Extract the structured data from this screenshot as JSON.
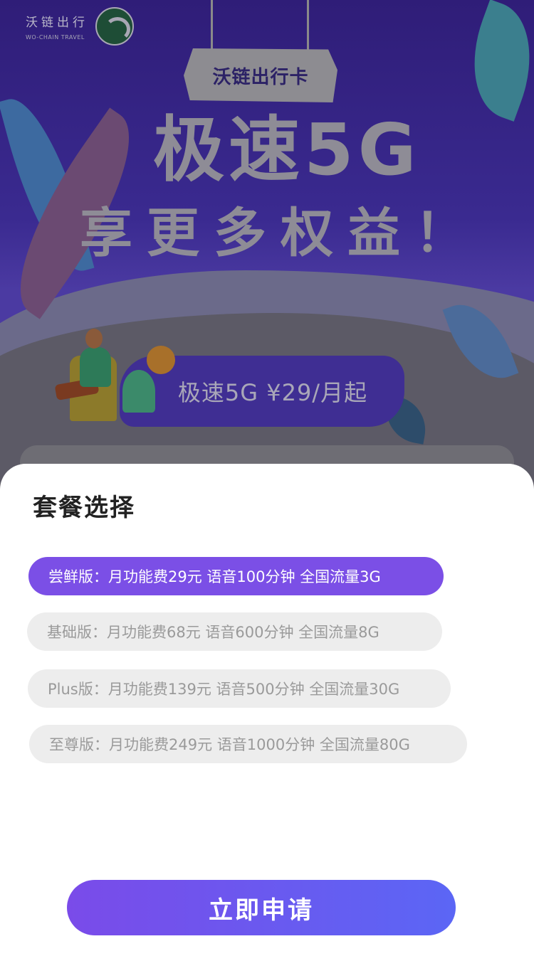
{
  "brand": {
    "name_cn": "沃链出行",
    "name_en": "WO-CHAIN TRAVEL"
  },
  "promo": {
    "card_title": "沃链出行卡",
    "headline_line1": "极速5G",
    "headline_line2": "享更多权益！",
    "price_banner": "极速5G ¥29/月起"
  },
  "sheet": {
    "title": "套餐选择",
    "plans": [
      {
        "label": "尝鲜版：月功能费29元 语音100分钟 全国流量3G",
        "selected": true
      },
      {
        "label": "基础版：月功能费68元 语音600分钟 全国流量8G",
        "selected": false
      },
      {
        "label": "Plus版：月功能费139元 语音500分钟 全国流量30G",
        "selected": false
      },
      {
        "label": "至尊版：月功能费249元 语音1000分钟 全国流量80G",
        "selected": false
      }
    ],
    "apply_label": "立即申请"
  },
  "colors": {
    "accent": "#7b4fe6",
    "button_gradient_start": "#7a4be9",
    "button_gradient_end": "#5b66f5",
    "overlay": "#555258"
  }
}
